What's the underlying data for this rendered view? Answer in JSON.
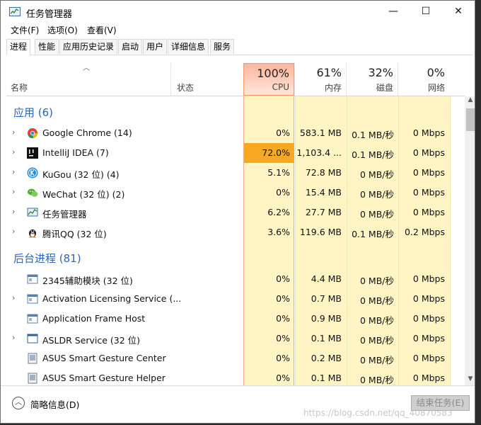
{
  "window": {
    "title": "任务管理器",
    "min": "—",
    "max": "☐",
    "close": "✕"
  },
  "menu": [
    "文件(F)",
    "选项(O)",
    "查看(V)"
  ],
  "tabs": [
    "进程",
    "性能",
    "应用历史记录",
    "启动",
    "用户",
    "详细信息",
    "服务"
  ],
  "header": {
    "name": "名称",
    "status": "状态",
    "cpu_pct": "100%",
    "cpu": "CPU",
    "mem_pct": "61%",
    "mem": "内存",
    "disk_pct": "32%",
    "disk": "磁盘",
    "net_pct": "0%",
    "net": "网络"
  },
  "groups": {
    "apps": "应用 (6)",
    "background": "后台进程 (81)"
  },
  "apps": [
    {
      "name": "Google Chrome (14)",
      "cpu": "0%",
      "mem": "583.1 MB",
      "disk": "0.1 MB/秒",
      "net": "0 Mbps",
      "icon": "chrome-icon"
    },
    {
      "name": "IntelliJ IDEA (7)",
      "cpu": "72.0%",
      "mem": "1,103.4 ...",
      "disk": "0.1 MB/秒",
      "net": "0 Mbps",
      "icon": "intellij-icon"
    },
    {
      "name": "KuGou (32 位) (4)",
      "cpu": "5.1%",
      "mem": "72.8 MB",
      "disk": "0 MB/秒",
      "net": "0 Mbps",
      "icon": "kugou-icon"
    },
    {
      "name": "WeChat (32 位) (2)",
      "cpu": "0%",
      "mem": "15.4 MB",
      "disk": "0 MB/秒",
      "net": "0 Mbps",
      "icon": "wechat-icon"
    },
    {
      "name": "任务管理器",
      "cpu": "6.2%",
      "mem": "27.7 MB",
      "disk": "0 MB/秒",
      "net": "0 Mbps",
      "icon": "task-manager-icon"
    },
    {
      "name": "腾讯QQ (32 位)",
      "cpu": "3.6%",
      "mem": "119.6 MB",
      "disk": "0.1 MB/秒",
      "net": "0.2 Mbps",
      "icon": "qq-icon"
    }
  ],
  "background": [
    {
      "name": "2345辅助模块 (32 位)",
      "cpu": "0%",
      "mem": "4.4 MB",
      "disk": "0 MB/秒",
      "net": "0 Mbps"
    },
    {
      "name": "Activation Licensing Service (...",
      "cpu": "0%",
      "mem": "0.7 MB",
      "disk": "0 MB/秒",
      "net": "0 Mbps"
    },
    {
      "name": "Application Frame Host",
      "cpu": "0%",
      "mem": "0.9 MB",
      "disk": "0 MB/秒",
      "net": "0 Mbps"
    },
    {
      "name": "ASLDR Service (32 位)",
      "cpu": "0%",
      "mem": "0.1 MB",
      "disk": "0 MB/秒",
      "net": "0 Mbps"
    },
    {
      "name": "ASUS Smart Gesture Center",
      "cpu": "0%",
      "mem": "0.2 MB",
      "disk": "0 MB/秒",
      "net": "0 Mbps"
    },
    {
      "name": "ASUS Smart Gesture Helper",
      "cpu": "0%",
      "mem": "0.1 MB",
      "disk": "0 MB/秒",
      "net": "0 Mbps"
    }
  ],
  "footer": {
    "fewer_details": "简略信息(D)",
    "end_task": "结束任务(E)"
  },
  "watermark": "https://blog.csdn.net/qq_40870583",
  "colors": {
    "group_heading": "#2f66b5",
    "cpu_hot": "#f7a823",
    "column_fill": "#fff4c4"
  }
}
